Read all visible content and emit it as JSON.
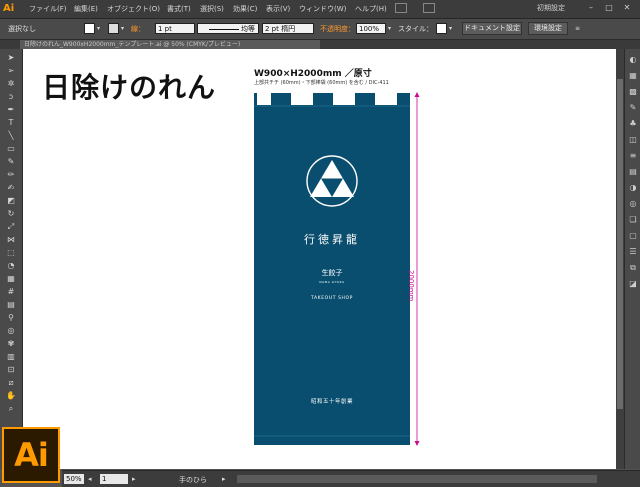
{
  "app": {
    "badge": "Ai",
    "workspace_label": "初期設定"
  },
  "menu": [
    "ファイル(F)",
    "編集(E)",
    "オブジェクト(O)",
    "書式(T)",
    "選択(S)",
    "効果(C)",
    "表示(V)",
    "ウィンドウ(W)",
    "ヘルプ(H)"
  ],
  "control_bar": {
    "selection_text": "選択なし",
    "stroke_label": "線：",
    "stroke_weight": "1 pt",
    "profile": "均等",
    "brush": "2 pt 楕円",
    "opacity_label": "不透明度：",
    "opacity_value": "100%",
    "style_label": "スタイル：",
    "doc_settings_button": "ドキュメント設定",
    "prefs_button": "環境設定"
  },
  "document_tab": {
    "title": "日除けのれん_W900xH2000mm_テンプレート.ai @ 50% (CMYK/プレビュー)"
  },
  "tools": [
    "selection-tool",
    "direct-selection-tool",
    "magic-wand-tool",
    "lasso-tool",
    "pen-tool",
    "type-tool",
    "line-tool",
    "rectangle-tool",
    "paintbrush-tool",
    "pencil-tool",
    "blob-brush-tool",
    "eraser-tool",
    "rotate-tool",
    "scale-tool",
    "width-tool",
    "free-transform-tool",
    "shape-builder-tool",
    "perspective-grid-tool",
    "mesh-tool",
    "gradient-tool",
    "eyedropper-tool",
    "blend-tool",
    "symbol-sprayer-tool",
    "column-graph-tool",
    "artboard-tool",
    "slice-tool",
    "hand-tool",
    "zoom-tool"
  ],
  "right_panel": [
    "color-panel-icon",
    "color-guide-icon",
    "swatches-icon",
    "brushes-icon",
    "symbols-icon",
    "graphic-styles-icon",
    "stroke-icon",
    "gradient-icon",
    "transparency-icon",
    "appearance-icon",
    "layers-icon",
    "artboards-icon",
    "align-icon",
    "transform-icon",
    "pathfinder-icon"
  ],
  "artboard": {
    "heading": "日除けのれん",
    "size_label": "W900×H2000mm ／原寸",
    "size_note": "上部共チチ (60mm)・下部棒袋 (60mm) を含む / DIC-411",
    "dimension_label": "2000mm"
  },
  "banner": {
    "color": "#094e6e",
    "shop_name": "行徳昇龍",
    "product": "生餃子",
    "product_romaji": "NAMA GYOZA",
    "service": "TAKEOUT SHOP",
    "founded": "昭和五十年創業"
  },
  "status": {
    "zoom": "50%",
    "page": "1",
    "tool_name": "手のひら"
  },
  "colors": {
    "accent": "#ff9a00",
    "dimension": "#cc0a8d"
  }
}
